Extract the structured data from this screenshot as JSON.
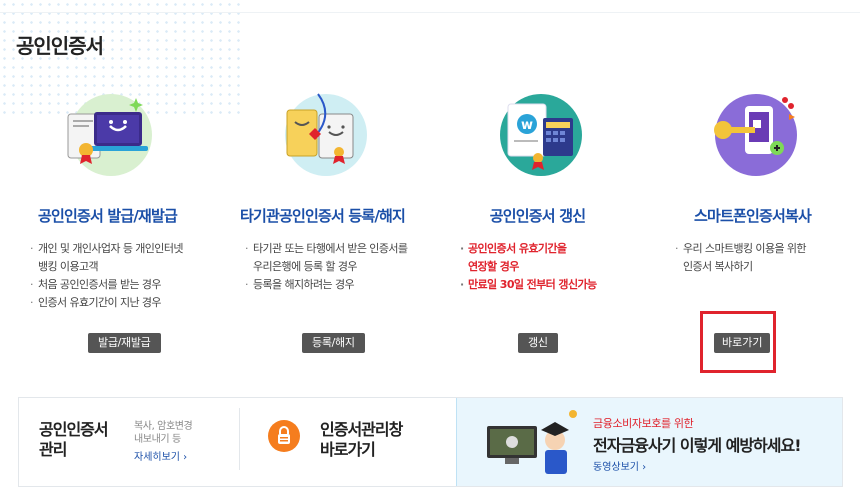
{
  "page": {
    "title": "공인인증서"
  },
  "cards": [
    {
      "title": "공인인증서 발급/재발급",
      "items": [
        "개인 및 개인사업자 등 개인인터넷",
        "뱅킹 이용고객",
        "처음 공인인증서를 받는 경우",
        "인증서 유효기간이 지난 경우"
      ],
      "button": "발급/재발급",
      "icon": "certificate-laptop-icon"
    },
    {
      "title": "타기관공인인증서 등록/해지",
      "items": [
        "타기관 또는 타행에서 받은 인증서를",
        "우리은행에 등록 할 경우",
        "등록을 해지하려는 경우"
      ],
      "button": "등록/해지",
      "icon": "certificate-documents-icon"
    },
    {
      "title": "공인인증서 갱신",
      "items": [
        "공인인증서 유효기간을",
        "연장할 경우",
        "만료일 30일 전부터 갱신가능"
      ],
      "button": "갱신",
      "icon": "certificate-calendar-icon"
    },
    {
      "title": "스마트폰인증서복사",
      "items": [
        "우리 스마트뱅킹 이용을 위한",
        "인증서 복사하기"
      ],
      "button": "바로가기",
      "icon": "smartphone-key-icon"
    }
  ],
  "bottom": {
    "manage": {
      "title_line1": "공인인증서",
      "title_line2": "관리",
      "sub_line1": "복사, 암호변경",
      "sub_line2": "내보내기 등",
      "more": "자세히보기 ›"
    },
    "window": {
      "title_line1": "인증서관리창",
      "title_line2": "바로가기"
    },
    "banner": {
      "small": "금융소비자보호를 위한",
      "big": "전자금융사기 이렇게 예방하세요!",
      "link": "동영상보기 ›"
    }
  },
  "colors": {
    "accent_blue": "#1b4fa8",
    "alert_red": "#e0232d",
    "button_gray": "#555555",
    "lock_orange": "#f57d1e"
  }
}
